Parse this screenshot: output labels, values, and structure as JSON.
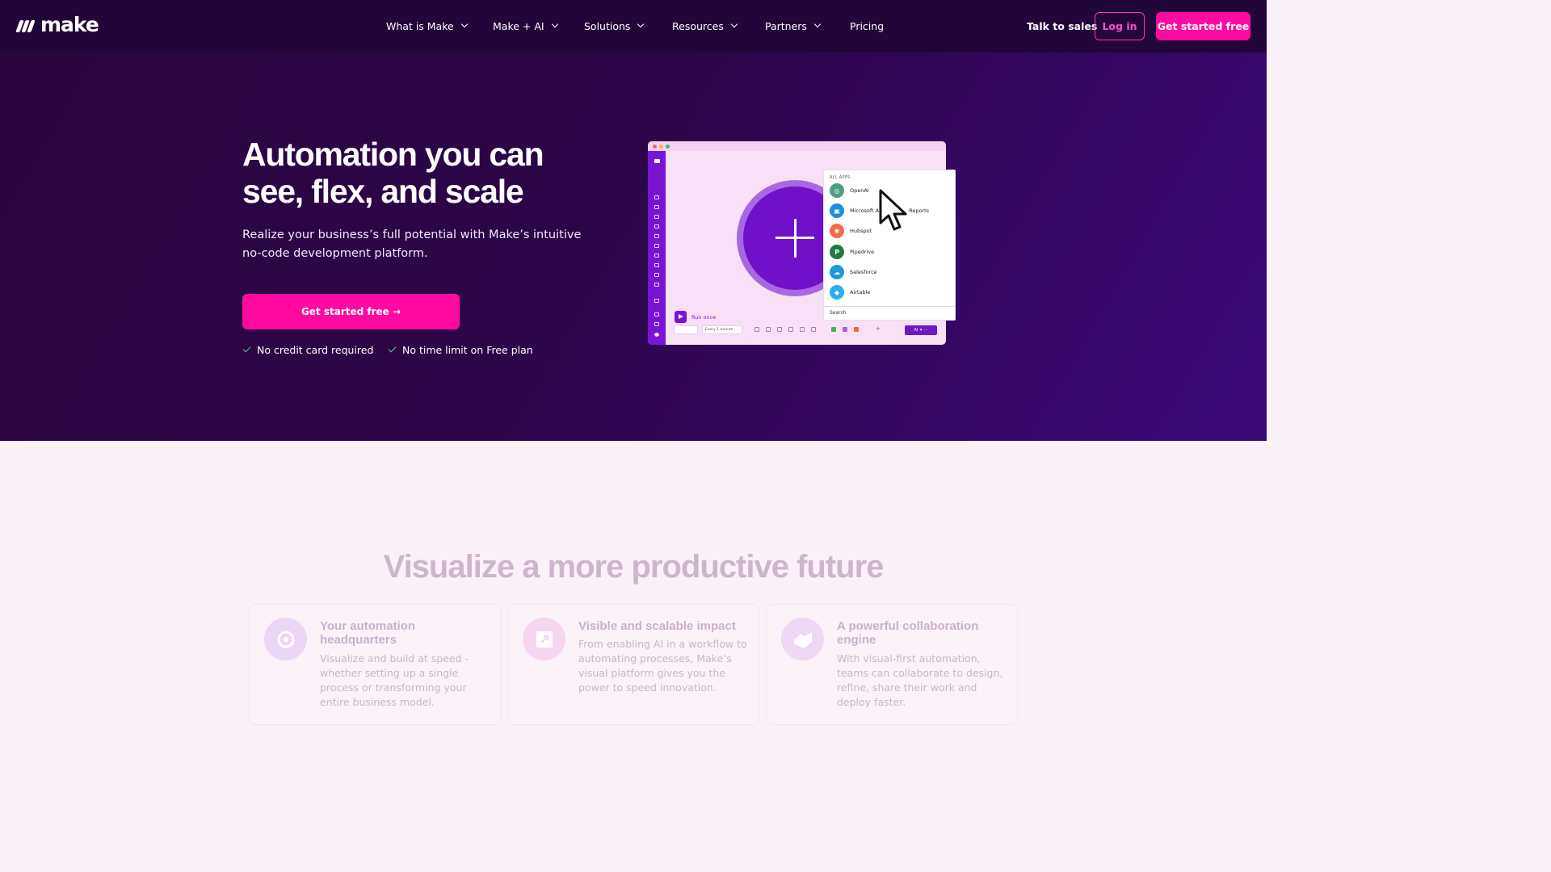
{
  "nav": {
    "logo_text": "make",
    "menu": [
      {
        "label": "What is Make",
        "dropdown": true
      },
      {
        "label": "Make + AI",
        "dropdown": true
      },
      {
        "label": "Solutions",
        "dropdown": true
      },
      {
        "label": "Resources",
        "dropdown": true
      },
      {
        "label": "Partners",
        "dropdown": true
      },
      {
        "label": "Pricing",
        "dropdown": false
      }
    ],
    "talk_to_sales": "Talk to sales",
    "login": "Log in",
    "get_started": "Get started free"
  },
  "hero": {
    "title": "Automation you can see, flex, and scale",
    "subtitle": "Realize your business’s full potential with Make’s intuitive no-code development platform.",
    "cta": "Get started free →",
    "checks": [
      "No credit card required",
      "No time limit on Free plan"
    ]
  },
  "mockup": {
    "apps_header": "ALL APPS",
    "apps": [
      {
        "name": "OpenAI",
        "color": "#4f9d86",
        "icon": "openai-icon",
        "glyph": "◎"
      },
      {
        "name": "Microsoft A",
        "name_tail": "Reports",
        "color": "#1c8fe0",
        "icon": "microsoft-icon",
        "glyph": "▣"
      },
      {
        "name": "Hubspot",
        "color": "#f46b4a",
        "icon": "hubspot-icon",
        "glyph": "✱"
      },
      {
        "name": "Pipedrive",
        "color": "#1f7a43",
        "icon": "pipedrive-icon",
        "glyph": "P"
      },
      {
        "name": "Salesforce",
        "color": "#1a9ad6",
        "icon": "salesforce-icon",
        "glyph": "☁"
      },
      {
        "name": "Airtable",
        "color": "#2aaef0",
        "icon": "airtable-icon",
        "glyph": "◆"
      }
    ],
    "search_label": "Search",
    "run_once": "Run once",
    "schedule": "Every 1 minute",
    "ai_button": "AI ✦ ···"
  },
  "section": {
    "title": "Visualize a more productive future",
    "cards": [
      {
        "title": "Your automation headquarters",
        "desc": "Visualize and build at speed - whether setting up a single process or transforming your entire business model.",
        "icon": "sync-icon",
        "icon_bg": "#ecd6f6"
      },
      {
        "title": "Visible and scalable impact",
        "desc": "From enabling AI in a workflow to automating processes, Make’s visual platform gives you the power to speed innovation.",
        "icon": "expand-icon",
        "icon_bg": "#f6d5ee"
      },
      {
        "title": "A powerful collaboration engine",
        "desc": "With visual-first automation, teams can collaborate to design, refine, share their work and deploy faster.",
        "icon": "handshake-icon",
        "icon_bg": "#efd8f4"
      }
    ]
  },
  "colors": {
    "accent": "#ff0aa0",
    "hero_bg": "#2a0640",
    "nav_bg": "#22063b",
    "section_bg": "#fbf1f8"
  }
}
